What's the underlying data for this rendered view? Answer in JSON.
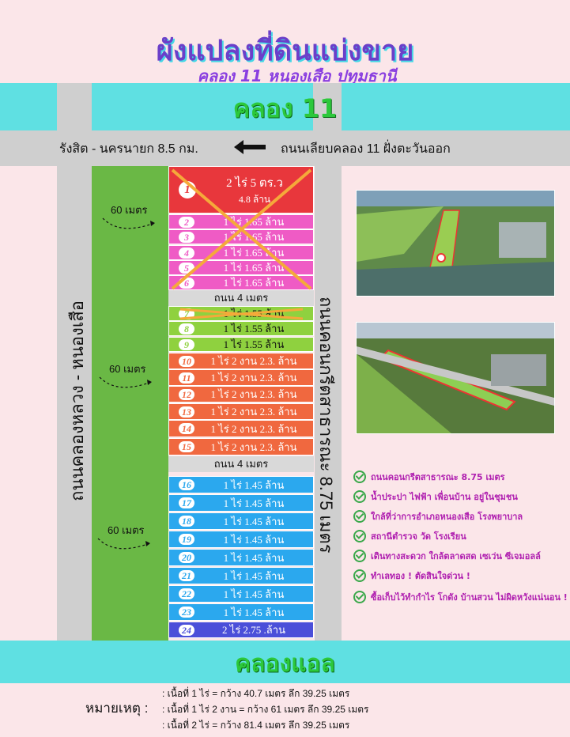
{
  "header": {
    "title": "ผังแปลงที่ดินแบ่งขาย",
    "subtitle": "คลอง 11 หนองเสือ ปทุมธานี"
  },
  "canal_top": "คลอง 11",
  "canal_bottom": "คลองแอล",
  "road_top": {
    "left_text": "รังสิต - นครนายก 8.5 กม.",
    "right_text": "ถนนเลียบคลอง 11 ฝั่งตะวันออก"
  },
  "road_left": "ถนนคลองหลวง - หนองเสือ",
  "road_right": "ถนนคอนกรีตสาธารณะ 8.75 เมตร",
  "inner_road": "ถนน 4 เมตร",
  "meter_label": "60 เมตร",
  "plots": [
    {
      "num": "1",
      "text": "2 ไร่ 5 ตร.ว",
      "sub": "4.8 ล้าน",
      "color": "#e8373c"
    },
    {
      "num": "2",
      "text": "1 ไร่ 1.65 ล้าน",
      "color": "#ef5bc5"
    },
    {
      "num": "3",
      "text": "1 ไร่ 1.65 ล้าน",
      "color": "#ef5bc5"
    },
    {
      "num": "4",
      "text": "1 ไร่ 1.65 ล้าน",
      "color": "#ef5bc5"
    },
    {
      "num": "5",
      "text": "1 ไร่ 1.65 ล้าน",
      "color": "#ef5bc5"
    },
    {
      "num": "6",
      "text": "1 ไร่ 1.65 ล้าน",
      "color": "#ef5bc5"
    },
    {
      "num": "7",
      "text": "1 ไร่ 1.55 ล้าน",
      "color": "#8fd13f"
    },
    {
      "num": "8",
      "text": "1 ไร่ 1.55 ล้าน",
      "color": "#8fd13f"
    },
    {
      "num": "9",
      "text": "1 ไร่ 1.55 ล้าน",
      "color": "#8fd13f"
    },
    {
      "num": "10",
      "text": "1 ไร่ 2 งาน 2.3. ล้าน",
      "color": "#f0683f"
    },
    {
      "num": "11",
      "text": "1 ไร่ 2 งาน 2.3. ล้าน",
      "color": "#f0683f"
    },
    {
      "num": "12",
      "text": "1 ไร่ 2 งาน 2.3. ล้าน",
      "color": "#f0683f"
    },
    {
      "num": "13",
      "text": "1 ไร่ 2 งาน 2.3. ล้าน",
      "color": "#f0683f"
    },
    {
      "num": "14",
      "text": "1 ไร่ 2 งาน 2.3. ล้าน",
      "color": "#f0683f"
    },
    {
      "num": "15",
      "text": "1 ไร่ 2 งาน 2.3. ล้าน",
      "color": "#f0683f"
    },
    {
      "num": "16",
      "text": "1 ไร่ 1.45 ล้าน",
      "color": "#2ba8ee"
    },
    {
      "num": "17",
      "text": "1 ไร่ 1.45 ล้าน",
      "color": "#2ba8ee"
    },
    {
      "num": "18",
      "text": "1 ไร่ 1.45 ล้าน",
      "color": "#2ba8ee"
    },
    {
      "num": "19",
      "text": "1 ไร่ 1.45 ล้าน",
      "color": "#2ba8ee"
    },
    {
      "num": "20",
      "text": "1 ไร่ 1.45 ล้าน",
      "color": "#2ba8ee"
    },
    {
      "num": "21",
      "text": "1 ไร่ 1.45 ล้าน",
      "color": "#2ba8ee"
    },
    {
      "num": "22",
      "text": "1 ไร่ 1.45 ล้าน",
      "color": "#2ba8ee"
    },
    {
      "num": "23",
      "text": "1 ไร่ 1.45 ล้าน",
      "color": "#2ba8ee"
    },
    {
      "num": "24",
      "text": "2 ไร่ 2.75 .ล้าน",
      "color": "#4b4fd9"
    }
  ],
  "features": [
    "ถนนคอนกรีตสาธารณะ 8.75 เมตร",
    "น้ำประปา ไฟฟ้า เพื่อนบ้าน อยู่ในชุมชน",
    "ใกล้ที่ว่าการอำเภอหนองเสือ โรงพยาบาล",
    "สถานีตำรวจ วัด โรงเรียน",
    "เดินทางสะดวก ใกล้ตลาดสด เซเว่น ซีเจมอลล์",
    "ทำเลทอง ! ตัดสินใจด่วน !",
    "ซื้อเก็บไว้ทำกำไร โกดัง บ้านสวน ไม่ผิดหวังแน่นอน !"
  ],
  "notes": {
    "label": "หมายเหตุ :",
    "lines": [
      ": เนื้อที่ 1 ไร่ = กว้าง 40.7 เมตร  ลึก 39.25 เมตร",
      ": เนื้อที่ 1 ไร่ 2 งาน = กว้าง 61 เมตร  ลึก 39.25 เมตร",
      ": เนื้อที่ 2 ไร่ = กว้าง 81.4 เมตร  ลึก 39.25 เมตร"
    ]
  }
}
